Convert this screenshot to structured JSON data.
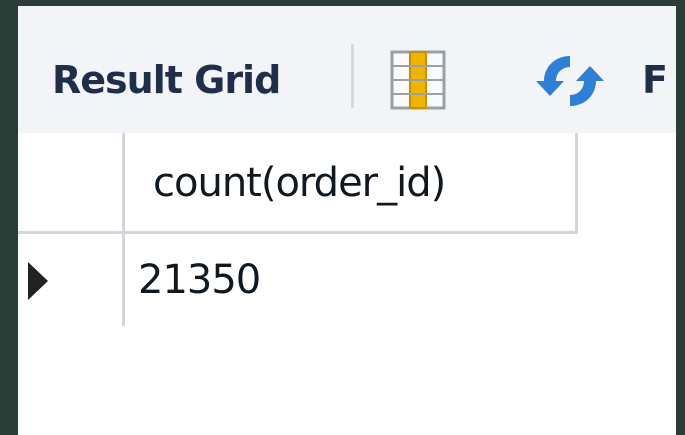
{
  "toolbar": {
    "result_grid_label": "Result Grid",
    "grid_icon": "grid-view-icon",
    "refresh_icon": "refresh-icon",
    "next_label_fragment": "F",
    "colors": {
      "toolbar_bg": "#f2f4f7",
      "label": "#1f2f4a",
      "grid_icon_accent": "#f0b400",
      "refresh_icon": "#2f7fd6"
    }
  },
  "grid": {
    "columns": [
      "count(order_id)"
    ],
    "rows": [
      {
        "indicator": "current-row-arrow-icon",
        "cells": [
          "21350"
        ]
      }
    ]
  },
  "colors": {
    "page_bg": "#2a3d36",
    "grid_border": "#d2d6da"
  }
}
